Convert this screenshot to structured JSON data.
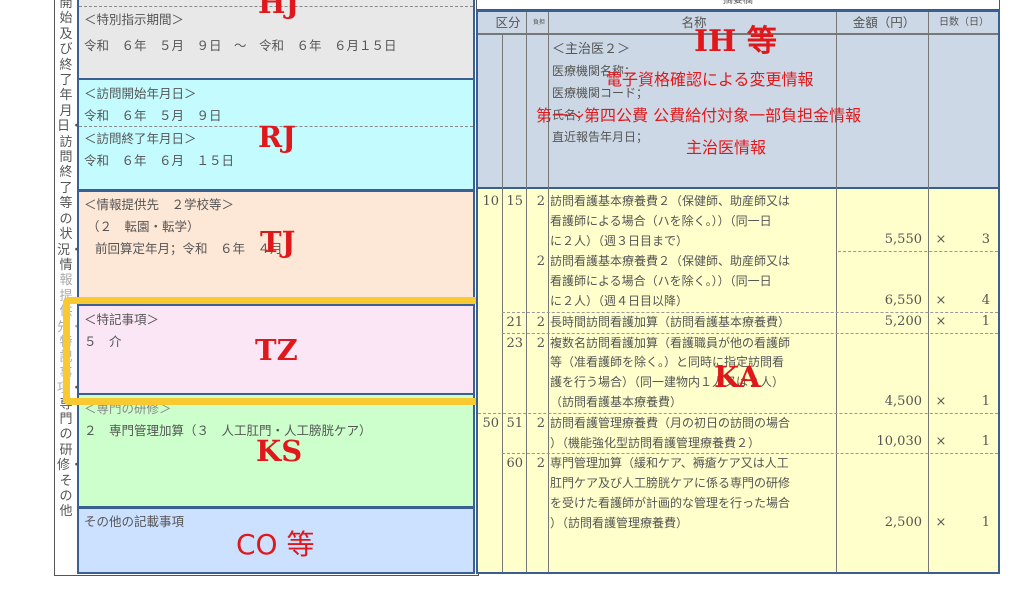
{
  "left_panel": {
    "vertical_label_top": "開始及び終了年月日・訪問終了等の状況・情",
    "vertical_label_mid_faded": "報提供先・特記事項",
    "vertical_label_bottom": "・専門の研修・その他",
    "special_instruction": {
      "heading": "＜特別指示期間＞",
      "value": "令和　６年　５月　９日　～　令和　６年　６月１５日",
      "record_code": "HJ"
    },
    "visit_dates": {
      "start_heading": "＜訪問開始年月日＞",
      "start_value": "令和　６年　５月　９日",
      "end_heading": "＜訪問終了年月日＞",
      "end_value": "令和　６年　６月　１５日",
      "record_code": "RJ"
    },
    "info_provision": {
      "heading": "＜情報提供先　２学校等＞",
      "line1": "（２　転園・転学）",
      "line2": "前回算定年月；令和　６年　４月",
      "record_code": "TJ"
    },
    "special_notes": {
      "heading": "＜特記事項＞",
      "value": "５　介",
      "record_code": "TZ"
    },
    "specialized_training": {
      "heading": "＜専門の研修＞",
      "value": "２　専門管理加算（３　人工肛門・人工膀胱ケア）",
      "record_code": "KS"
    },
    "other_notes": {
      "heading": "その他の記載事項",
      "record_code": "CO 等"
    }
  },
  "right_panel": {
    "summary_title": "摘要欄",
    "columns": {
      "category": "区分",
      "burden": "負担",
      "name": "名称",
      "amount": "金額（円）",
      "days": "日数（日）"
    },
    "header_block": {
      "doctor_heading": "＜主治医２＞",
      "lines": [
        "医療機関名称；",
        "医療機関コード；",
        "氏名；",
        "直近報告年月日；"
      ],
      "record_code": "IH 等",
      "annotations": [
        "電子資格確認による変更情報",
        "第一～第四公費 公費給付対象一部負担金情報",
        "主治医情報"
      ]
    },
    "rows": [
      {
        "cat1": "10",
        "cat2": "15",
        "burden": "2",
        "name": "訪問看護基本療養費２（保健師、助産師又は\n看護師による場合（ハを除く。））（同一日\nに２人）（週３日目まで）",
        "amount": "5,550",
        "times": "×",
        "days": "3"
      },
      {
        "cat1": "",
        "cat2": "",
        "burden": "2",
        "name": "訪問看護基本療養費２（保健師、助産師又は\n看護師による場合（ハを除く。））（同一日\nに２人）（週４日目以降）",
        "amount": "6,550",
        "times": "×",
        "days": "4"
      },
      {
        "cat1": "",
        "cat2": "21",
        "burden": "2",
        "name": "長時間訪問看護加算（訪問看護基本療養費）",
        "amount": "5,200",
        "times": "×",
        "days": "1"
      },
      {
        "cat1": "",
        "cat2": "23",
        "burden": "2",
        "name": "複数名訪問看護加算（看護職員が他の看護師\n等（准看護師を除く。）と同時に指定訪問看\n護を行う場合）（同一建物内１人又は２人）\n（訪問看護基本療養費）",
        "amount": "4,500",
        "times": "×",
        "days": "1"
      },
      {
        "cat1": "50",
        "cat2": "51",
        "burden": "2",
        "name": "訪問看護管理療養費（月の初日の訪問の場合\n）（機能強化型訪問看護管理療養費２）",
        "amount": "10,030",
        "times": "×",
        "days": "1"
      },
      {
        "cat1": "",
        "cat2": "60",
        "burden": "2",
        "name": "専門管理加算（緩和ケア、褥瘡ケア又は人工\n肛門ケア及び人工膀胱ケアに係る専門の研修\nを受けた看護師が計画的な管理を行った場合\n）（訪問看護管理療養費）",
        "amount": "2,500",
        "times": "×",
        "days": "1"
      }
    ],
    "body_record_code": "KA"
  },
  "colors": {
    "hj_bg": "#e8e8e8",
    "rj_bg": "#c4fbff",
    "tj_bg": "#fde7d6",
    "tz_bg": "#fbe6f6",
    "ks_bg": "#ccffcc",
    "co_bg": "#cce0ff",
    "header_bg": "#ccd8e6",
    "body_bg": "#ffffcc",
    "highlight": "#f9c932",
    "annotation_red": "#e0181b",
    "border_blue": "#3a5f91"
  }
}
